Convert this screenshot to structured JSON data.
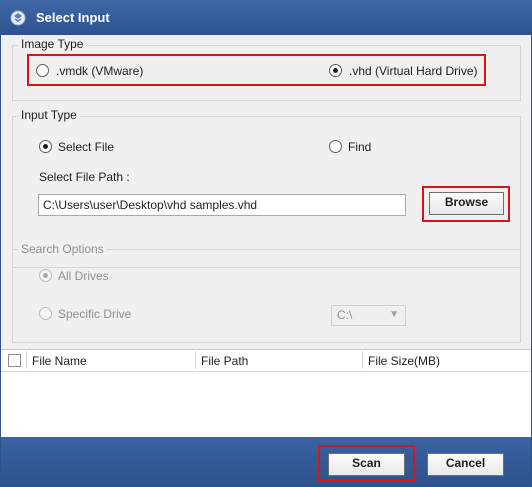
{
  "window": {
    "title": "Select Input"
  },
  "image_type": {
    "legend": "Image Type",
    "options": [
      {
        "label": ".vmdk (VMware)",
        "checked": false
      },
      {
        "label": ".vhd (Virtual Hard Drive)",
        "checked": true
      }
    ]
  },
  "input_type": {
    "legend": "Input Type",
    "options": [
      {
        "label": "Select File",
        "checked": true
      },
      {
        "label": "Find",
        "checked": false
      }
    ],
    "path_label": "Select File Path :",
    "path_value": "C:\\Users\\user\\Desktop\\vhd samples.vhd",
    "browse_label": "Browse"
  },
  "search_options": {
    "legend": "Search Options",
    "options": [
      {
        "label": "All Drives",
        "checked": true
      },
      {
        "label": "Specific Drive",
        "checked": false
      }
    ],
    "drive_value": "C:\\"
  },
  "file_table": {
    "columns": [
      "File Name",
      "File Path",
      "File Size(MB)"
    ]
  },
  "footer": {
    "scan_label": "Scan",
    "cancel_label": "Cancel"
  },
  "colors": {
    "titlebar": "#2d538f",
    "highlight": "#d9141b"
  }
}
